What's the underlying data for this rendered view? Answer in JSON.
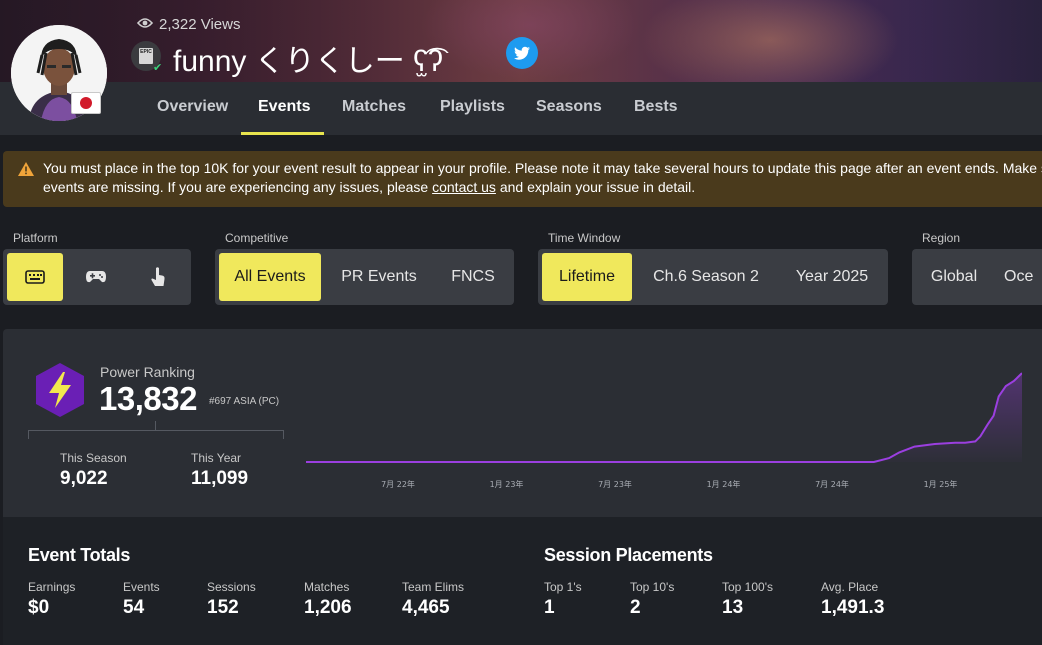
{
  "profile": {
    "views": "2,322 Views",
    "name": "funny くりくしー ʕ̫͡ʔ",
    "epic_badge_text": "EPIC",
    "country_flag": "japan-flag-icon",
    "accent": "#e8e44e"
  },
  "nav": {
    "tabs": [
      {
        "label": "Overview"
      },
      {
        "label": "Events"
      },
      {
        "label": "Matches"
      },
      {
        "label": "Playlists"
      },
      {
        "label": "Seasons"
      },
      {
        "label": "Bests"
      }
    ],
    "active": "Events"
  },
  "alert": {
    "line1": "You must place in the top 10K for your event result to appear in your profile. Please note it may take several hours to update this page after an event ends. Make s",
    "line2_before": "events are missing. If you are experiencing any issues, please ",
    "link": "contact us",
    "line2_after": " and explain your issue in detail.",
    "color": "#4a3a1c"
  },
  "filters": {
    "platform": {
      "label": "Platform",
      "options": [
        "keyboard-icon",
        "gamepad-icon",
        "touch-icon"
      ],
      "selected": "keyboard-icon"
    },
    "competitive": {
      "label": "Competitive",
      "options": [
        "All Events",
        "PR Events",
        "FNCS"
      ],
      "selected": "All Events"
    },
    "time_window": {
      "label": "Time Window",
      "options": [
        "Lifetime",
        "Ch.6 Season 2",
        "Year 2025"
      ],
      "selected": "Lifetime"
    },
    "region": {
      "label": "Region",
      "options": [
        "Global",
        "Oce"
      ],
      "selected": "Global"
    }
  },
  "power_ranking": {
    "label": "Power Ranking",
    "value": "13,832",
    "rank": "#697 ASIA (PC)",
    "this_season_label": "This Season",
    "this_season_value": "9,022",
    "this_year_label": "This Year",
    "this_year_value": "11,099"
  },
  "chart_data": {
    "type": "line",
    "x_tick_labels": [
      "7月 22年",
      "1月 23年",
      "7月 23年",
      "1月 24年",
      "7月 24年",
      "1月 25年"
    ],
    "series": [
      {
        "color": "#9b3fe0",
        "points": [
          [
            0,
            0
          ],
          [
            560,
            0
          ],
          [
            575,
            600
          ],
          [
            585,
            1500
          ],
          [
            600,
            2400
          ],
          [
            620,
            2800
          ],
          [
            640,
            3000
          ],
          [
            650,
            3000
          ],
          [
            660,
            3200
          ],
          [
            665,
            4000
          ],
          [
            672,
            5800
          ],
          [
            678,
            7200
          ],
          [
            683,
            10200
          ],
          [
            690,
            11800
          ],
          [
            698,
            12600
          ],
          [
            706,
            13832
          ]
        ]
      }
    ],
    "xlim": [
      0,
      706
    ],
    "ylim": [
      0,
      14000
    ],
    "grid": false,
    "legend": "none"
  },
  "event_totals": {
    "title": "Event Totals",
    "items": [
      {
        "label": "Earnings",
        "value": "$0"
      },
      {
        "label": "Events",
        "value": "54"
      },
      {
        "label": "Sessions",
        "value": "152"
      },
      {
        "label": "Matches",
        "value": "1,206"
      },
      {
        "label": "Team Elims",
        "value": "4,465"
      }
    ]
  },
  "session_placements": {
    "title": "Session Placements",
    "items": [
      {
        "label": "Top 1's",
        "value": "1"
      },
      {
        "label": "Top 10's",
        "value": "2"
      },
      {
        "label": "Top 100's",
        "value": "13"
      },
      {
        "label": "Avg. Place",
        "value": "1,491.3"
      }
    ]
  }
}
